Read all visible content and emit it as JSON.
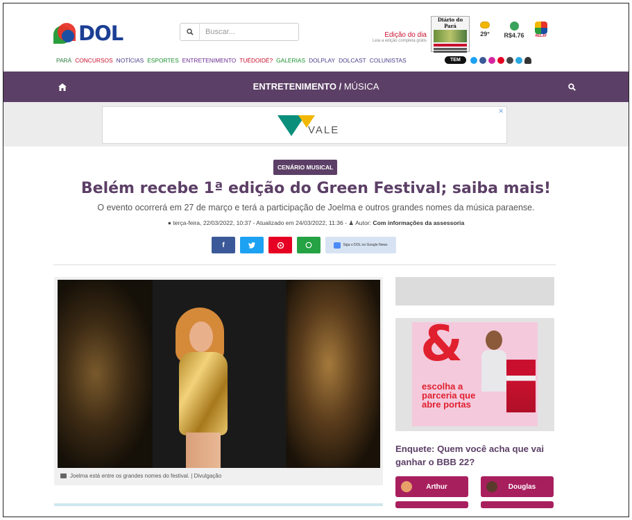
{
  "header": {
    "logo_text": "DOL",
    "search_placeholder": "Buscar...",
    "edition_title": "Edição do dia",
    "edition_sub": "Leia a edição completa grátis",
    "newspaper_name": "Diário do Pará",
    "temperature": "29°",
    "currency": "R$4.76",
    "relay_label": "RELAY"
  },
  "nav": {
    "items": [
      "PARÁ",
      "CONCURSOS",
      "NOTÍCIAS",
      "ESPORTES",
      "ENTRETENIMENTO",
      "TUÉDOIDÉ?",
      "GALERIAS",
      "DOLPLAY",
      "DOLCAST",
      "COLUNISTAS"
    ],
    "tem_label": "TEM"
  },
  "section_bar": {
    "section": "ENTRETENIMENTO /",
    "subsection": " MÚSICA"
  },
  "ad_banner": {
    "brand": "VALE",
    "close": "✕"
  },
  "article": {
    "badge": "CENÁRIO MUSICAL",
    "title": "Belém recebe 1ª edição do Green Festival; saiba mais!",
    "subtitle": "O evento ocorrerá em 27 de março e terá a participação de Joelma e outros grandes nomes da música paraense.",
    "meta_date": "terça-feira, 22/03/2022, 10:37 - Atualizado em 24/03/2022, 11:36 -",
    "meta_author_prefix": "Autor:",
    "meta_author": "Com informações da assessoria",
    "google_news_label": "Siga o DOL no Google News",
    "photo_caption": "Joelma está entre os grandes nomes do festival. | Divulgação"
  },
  "share": {
    "facebook": "f",
    "twitter": "t",
    "pinterest": "p",
    "whatsapp": "w"
  },
  "sidebar": {
    "ad_symbol": "&",
    "ad_text": "escolha a parceria que abre portas",
    "poll_title": "Enquete: Quem você acha que vai ganhar o BBB 22?",
    "poll_options": [
      "Arthur",
      "Douglas"
    ]
  },
  "colors": {
    "purple": "#5c3f66",
    "poll_button": "#a81f5e",
    "facebook": "#3b5998",
    "twitter": "#1da1f2",
    "pinterest": "#e60023",
    "whatsapp": "#25a244"
  }
}
